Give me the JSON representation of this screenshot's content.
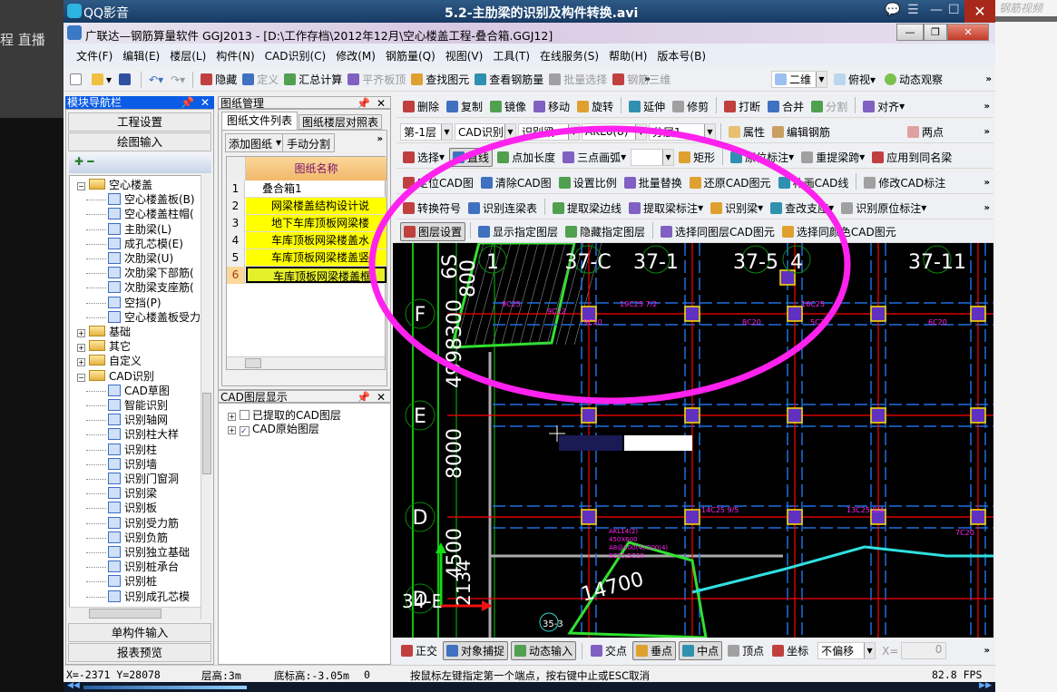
{
  "background": {
    "left_text": "程   直播",
    "right_watermark": "钢筋视频"
  },
  "player": {
    "app_name": "QQ影音",
    "video_title": "5.2-主肋梁的识别及构件转换.avi",
    "controls": [
      "chat-icon",
      "playlist-icon",
      "minimize-icon",
      "maximize-icon",
      "close-icon"
    ]
  },
  "window": {
    "title": "广联达—钢筋算量软件 GGJ2013 - [D:\\工作存档\\2012年12月\\空心楼盖工程-叠合箱.GGJ12]"
  },
  "menu": [
    "文件(F)",
    "编辑(E)",
    "楼层(L)",
    "构件(N)",
    "CAD识别(C)",
    "修改(M)",
    "钢筋量(Q)",
    "视图(V)",
    "工具(T)",
    "在线服务(S)",
    "帮助(H)",
    "版本号(B)"
  ],
  "toolbar1": {
    "items": [
      "隐藏",
      "定义",
      "汇总计算",
      "平齐板顶",
      "查找图元",
      "查看钢筋量",
      "批量选择",
      "钢筋三维"
    ],
    "view_mode": "二维",
    "view_dir": "俯视",
    "dynamic": "动态观察"
  },
  "toolbar2": [
    "删除",
    "复制",
    "镜像",
    "移动",
    "旋转",
    "延伸",
    "修剪",
    "打断",
    "合并",
    "分割",
    "对齐"
  ],
  "toolbar3": {
    "floor": "第-1层",
    "type": "CAD识别",
    "sub": "识别梁",
    "element": "AKL6(8)",
    "layer": "分层1",
    "props": "属性",
    "edit_rebar": "编辑钢筋",
    "two_point": "两点"
  },
  "toolbar4": [
    "选择",
    "直线",
    "点加长度",
    "三点画弧",
    "矩形",
    "原位标注",
    "重提梁跨",
    "应用到同名梁"
  ],
  "toolbar5": [
    "定位CAD图",
    "清除CAD图",
    "设置比例",
    "批量替换",
    "还原CAD图元",
    "补画CAD线",
    "修改CAD标注"
  ],
  "toolbar6": [
    "转换符号",
    "识别连梁表",
    "提取梁边线",
    "提取梁标注",
    "识别梁",
    "查改支座",
    "识别原位标注"
  ],
  "toolbar7": [
    "图层设置",
    "显示指定图层",
    "隐藏指定图层",
    "选择同图层CAD图元",
    "选择同颜色CAD图元"
  ],
  "nav": {
    "title": "模块导航栏",
    "buttons": [
      "工程设置",
      "绘图输入",
      "单构件输入",
      "报表预览"
    ],
    "tree": [
      {
        "label": "空心楼盖",
        "level": 0,
        "folder": true,
        "exp": "−"
      },
      {
        "label": "空心楼盖板(B)",
        "level": 1
      },
      {
        "label": "空心楼盖柱帽(",
        "level": 1
      },
      {
        "label": "主肋梁(L)",
        "level": 1
      },
      {
        "label": "成孔芯模(E)",
        "level": 1
      },
      {
        "label": "次肋梁(U)",
        "level": 1
      },
      {
        "label": "次肋梁下部筋(",
        "level": 1
      },
      {
        "label": "次肋梁支座筋(",
        "level": 1
      },
      {
        "label": "空挡(P)",
        "level": 1
      },
      {
        "label": "空心楼盖板受力",
        "level": 1
      },
      {
        "label": "基础",
        "level": 0,
        "folder": true,
        "exp": "+"
      },
      {
        "label": "其它",
        "level": 0,
        "folder": true,
        "exp": "+"
      },
      {
        "label": "自定义",
        "level": 0,
        "folder": true,
        "exp": "+"
      },
      {
        "label": "CAD识别",
        "level": 0,
        "folder": true,
        "exp": "−"
      },
      {
        "label": "CAD草图",
        "level": 1
      },
      {
        "label": "智能识别",
        "level": 1
      },
      {
        "label": "识别轴网",
        "level": 1
      },
      {
        "label": "识别柱大样",
        "level": 1
      },
      {
        "label": "识别柱",
        "level": 1
      },
      {
        "label": "识别墙",
        "level": 1
      },
      {
        "label": "识别门窗洞",
        "level": 1
      },
      {
        "label": "识别梁",
        "level": 1
      },
      {
        "label": "识别板",
        "level": 1
      },
      {
        "label": "识别受力筋",
        "level": 1
      },
      {
        "label": "识别负筋",
        "level": 1
      },
      {
        "label": "识别独立基础",
        "level": 1
      },
      {
        "label": "识别桩承台",
        "level": 1
      },
      {
        "label": "识别桩",
        "level": 1
      },
      {
        "label": "识别成孔芯模",
        "level": 1
      }
    ]
  },
  "drawings": {
    "title": "图纸管理",
    "tabs": [
      "图纸文件列表",
      "图纸楼层对照表"
    ],
    "add": "添加图纸",
    "split": "手动分割",
    "col_header": "图纸名称",
    "rows": [
      {
        "n": "1",
        "name": "叠合箱1"
      },
      {
        "n": "2",
        "name": "网梁楼盖结构设计说"
      },
      {
        "n": "3",
        "name": "地下车库顶板网梁楼"
      },
      {
        "n": "4",
        "name": "车库顶板网梁楼盖水"
      },
      {
        "n": "5",
        "name": "车库顶板网梁楼盖竖"
      },
      {
        "n": "6",
        "name": "车库顶板网梁楼盖框"
      }
    ]
  },
  "layers": {
    "title": "CAD图层显示",
    "items": [
      {
        "label": "已提取的CAD图层",
        "checked": false
      },
      {
        "label": "CAD原始图层",
        "checked": true
      }
    ]
  },
  "cad": {
    "row_axes": [
      "F",
      "E",
      "D",
      "D"
    ],
    "top_labels": [
      "1",
      "37-C",
      "37-1",
      "37-5",
      "4",
      "37-11"
    ],
    "dims": [
      "8000",
      "4500",
      "4998300",
      "6S",
      "800",
      "14700",
      "34-E",
      "2134",
      "35-3"
    ],
    "beam_labels": [
      "9C25",
      "9C20",
      "9C22",
      "8C20",
      "5C20",
      "6C20",
      "19C25 7/2",
      "16C25",
      "14C25 9/5",
      "13C25 9/4",
      "7C20",
      "AKL14(2)",
      "450X600",
      "A8@100(4)/200(4)",
      "6C25,5C20"
    ]
  },
  "snap": {
    "items": [
      "正交",
      "对象捕捉",
      "动态输入",
      "交点",
      "垂点",
      "中点",
      "顶点",
      "坐标"
    ],
    "offset": "不偏移",
    "x_label": "X=",
    "x_value": "0"
  },
  "status": {
    "coords": "X=-2371 Y=28078",
    "floor_height": "层高:3m",
    "base_elev": "底标高:-3.05m",
    "value": "0",
    "hint": "按鼠标左键指定第一个端点，按右键中止或ESC取消",
    "fps": "82.8 FPS"
  },
  "colors": {
    "highlight_row": "#ffff00",
    "annotation": "#ff22ee",
    "cad_bg": "#000000",
    "axis_red": "#ff0000",
    "beam_blue": "#1e6fe0"
  }
}
